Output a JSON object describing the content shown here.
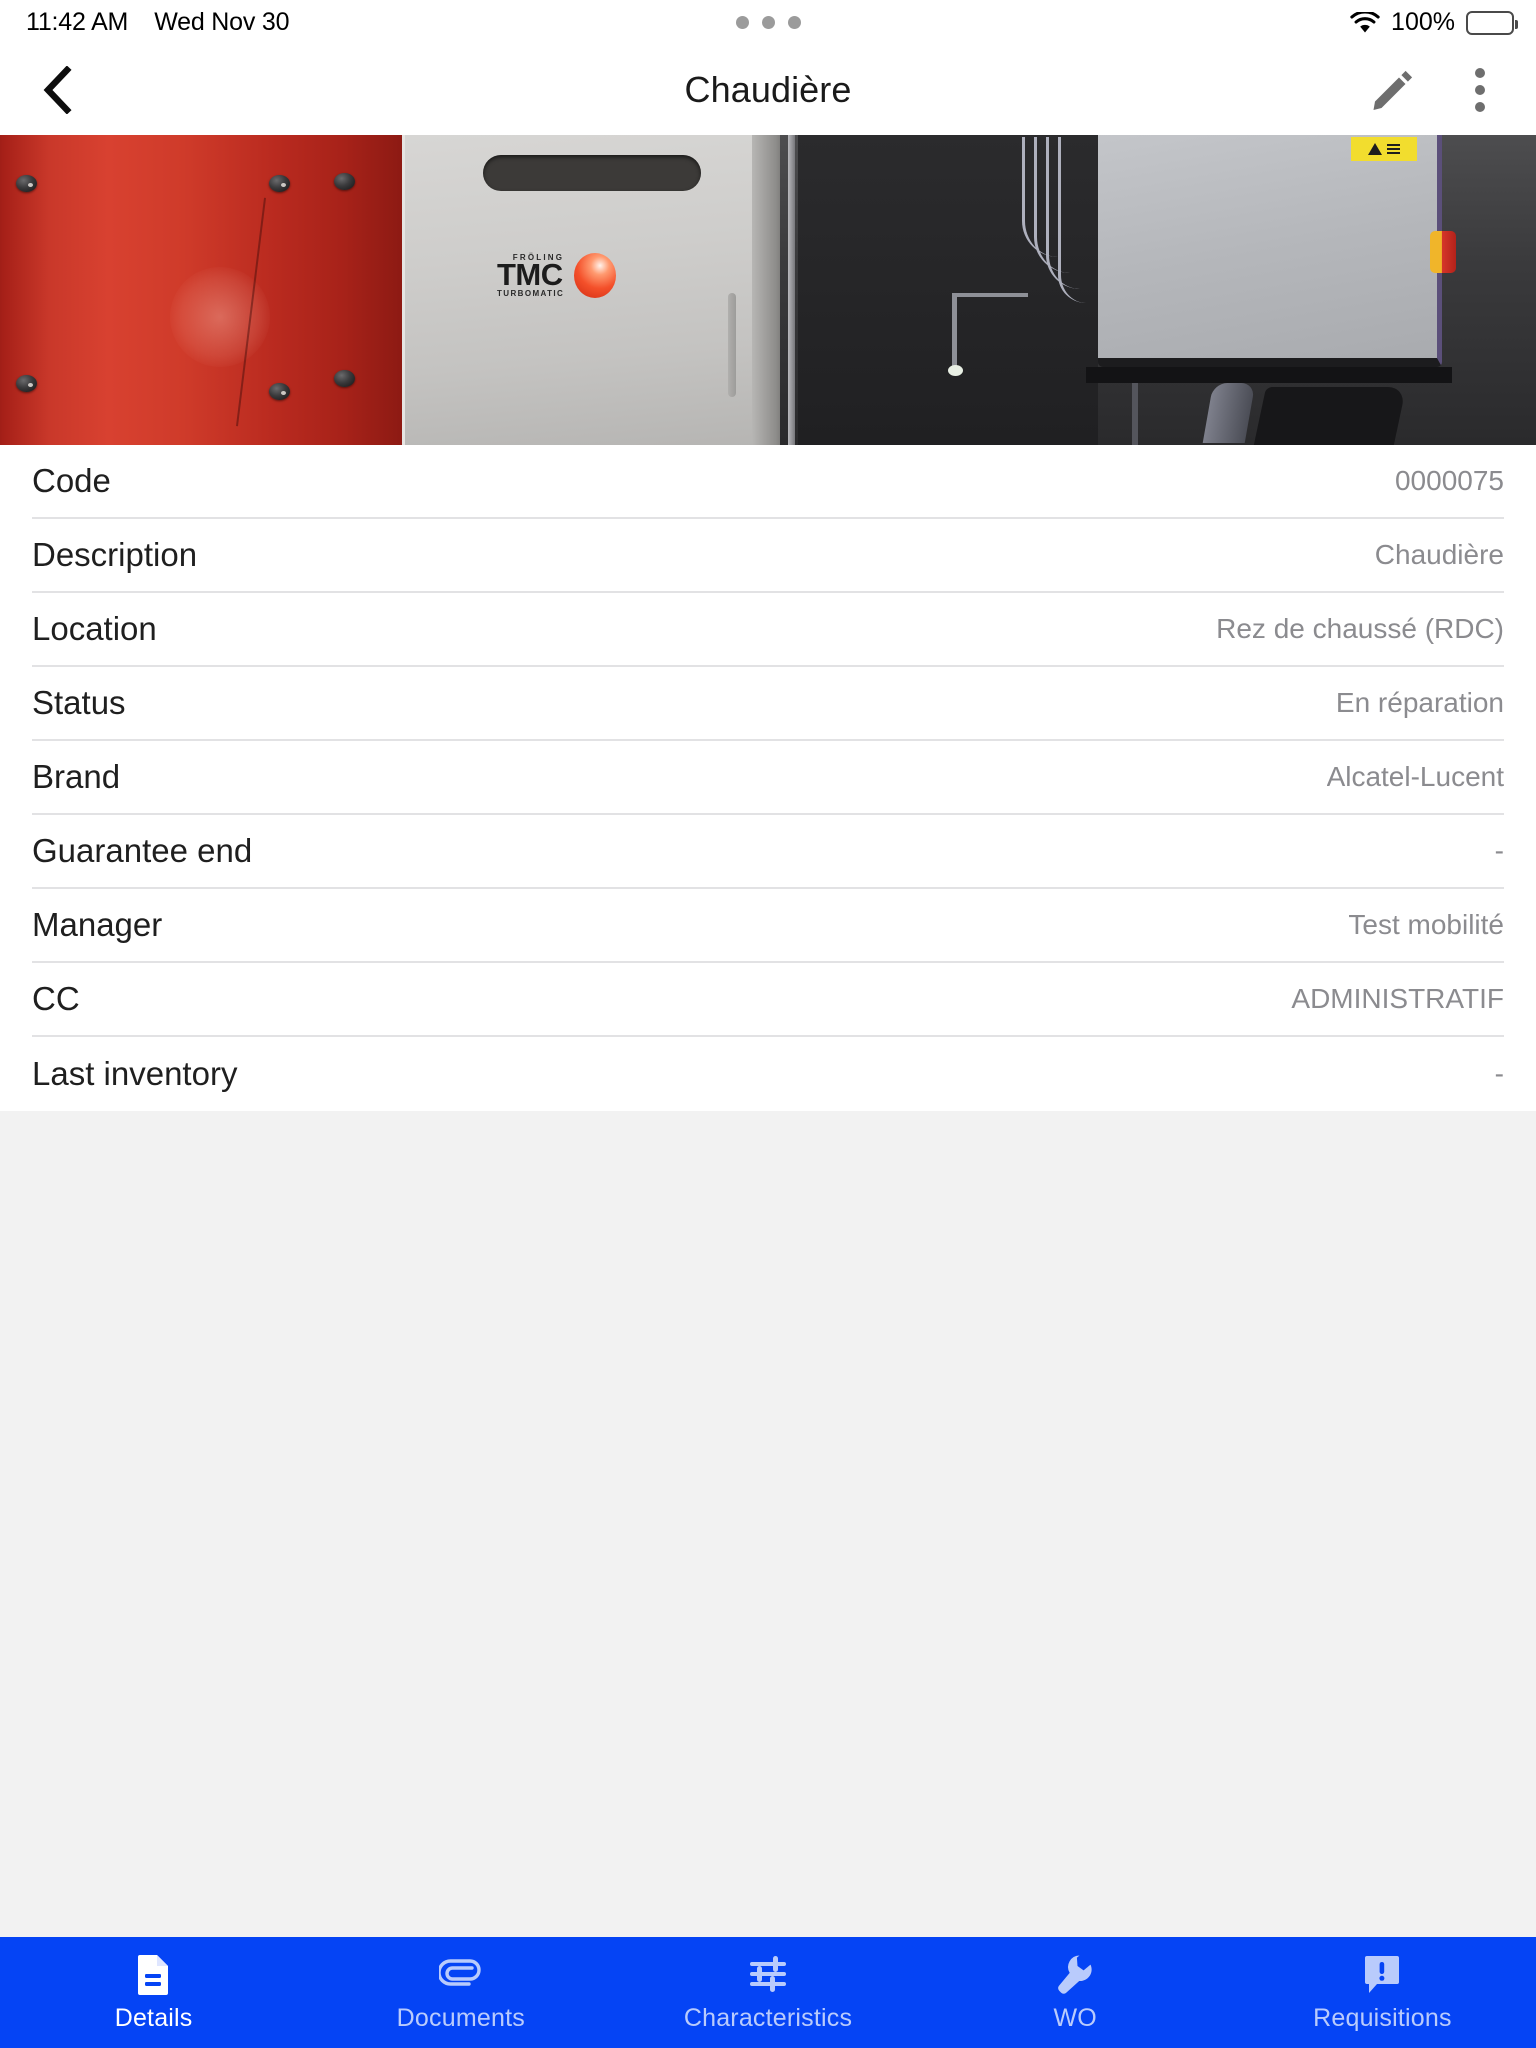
{
  "status_bar": {
    "time": "11:42 AM",
    "date": "Wed Nov 30",
    "battery_percent": "100%",
    "wifi_icon": "wifi-icon",
    "battery_icon": "battery-icon",
    "dots_icon": "multitasking-dots-indicator"
  },
  "nav_bar": {
    "title": "Chaudière",
    "back_icon": "chevron-left-icon",
    "edit_icon": "pencil-edit-icon",
    "more_icon": "kebab-menu-icon"
  },
  "hero": {
    "alt": "Photo of a Fröling TMC Turbomatic boiler next to a red buffer tank in a plant room",
    "equipment_brand": "FRÖLING",
    "equipment_model": "TMC",
    "equipment_series": "TURBOMATIC"
  },
  "details": {
    "rows": [
      {
        "label": "Code",
        "value": "0000075"
      },
      {
        "label": "Description",
        "value": "Chaudière"
      },
      {
        "label": "Location",
        "value": "Rez de chaussé (RDC)"
      },
      {
        "label": "Status",
        "value": "En réparation"
      },
      {
        "label": "Brand",
        "value": "Alcatel-Lucent"
      },
      {
        "label": "Guarantee end",
        "value": "-"
      },
      {
        "label": "Manager",
        "value": "Test mobilité"
      },
      {
        "label": "CC",
        "value": "ADMINISTRATIF"
      },
      {
        "label": "Last inventory",
        "value": "-"
      }
    ]
  },
  "tab_bar": {
    "accent_color": "#0544f5",
    "active_index": 0,
    "items": [
      {
        "label": "Details",
        "icon": "document-icon",
        "active": true
      },
      {
        "label": "Documents",
        "icon": "paperclip-icon",
        "active": false
      },
      {
        "label": "Characteristics",
        "icon": "sliders-icon",
        "active": false
      },
      {
        "label": "WO",
        "icon": "wrench-icon",
        "active": false
      },
      {
        "label": "Requisitions",
        "icon": "alert-speech-bubble-icon",
        "active": false
      }
    ]
  }
}
